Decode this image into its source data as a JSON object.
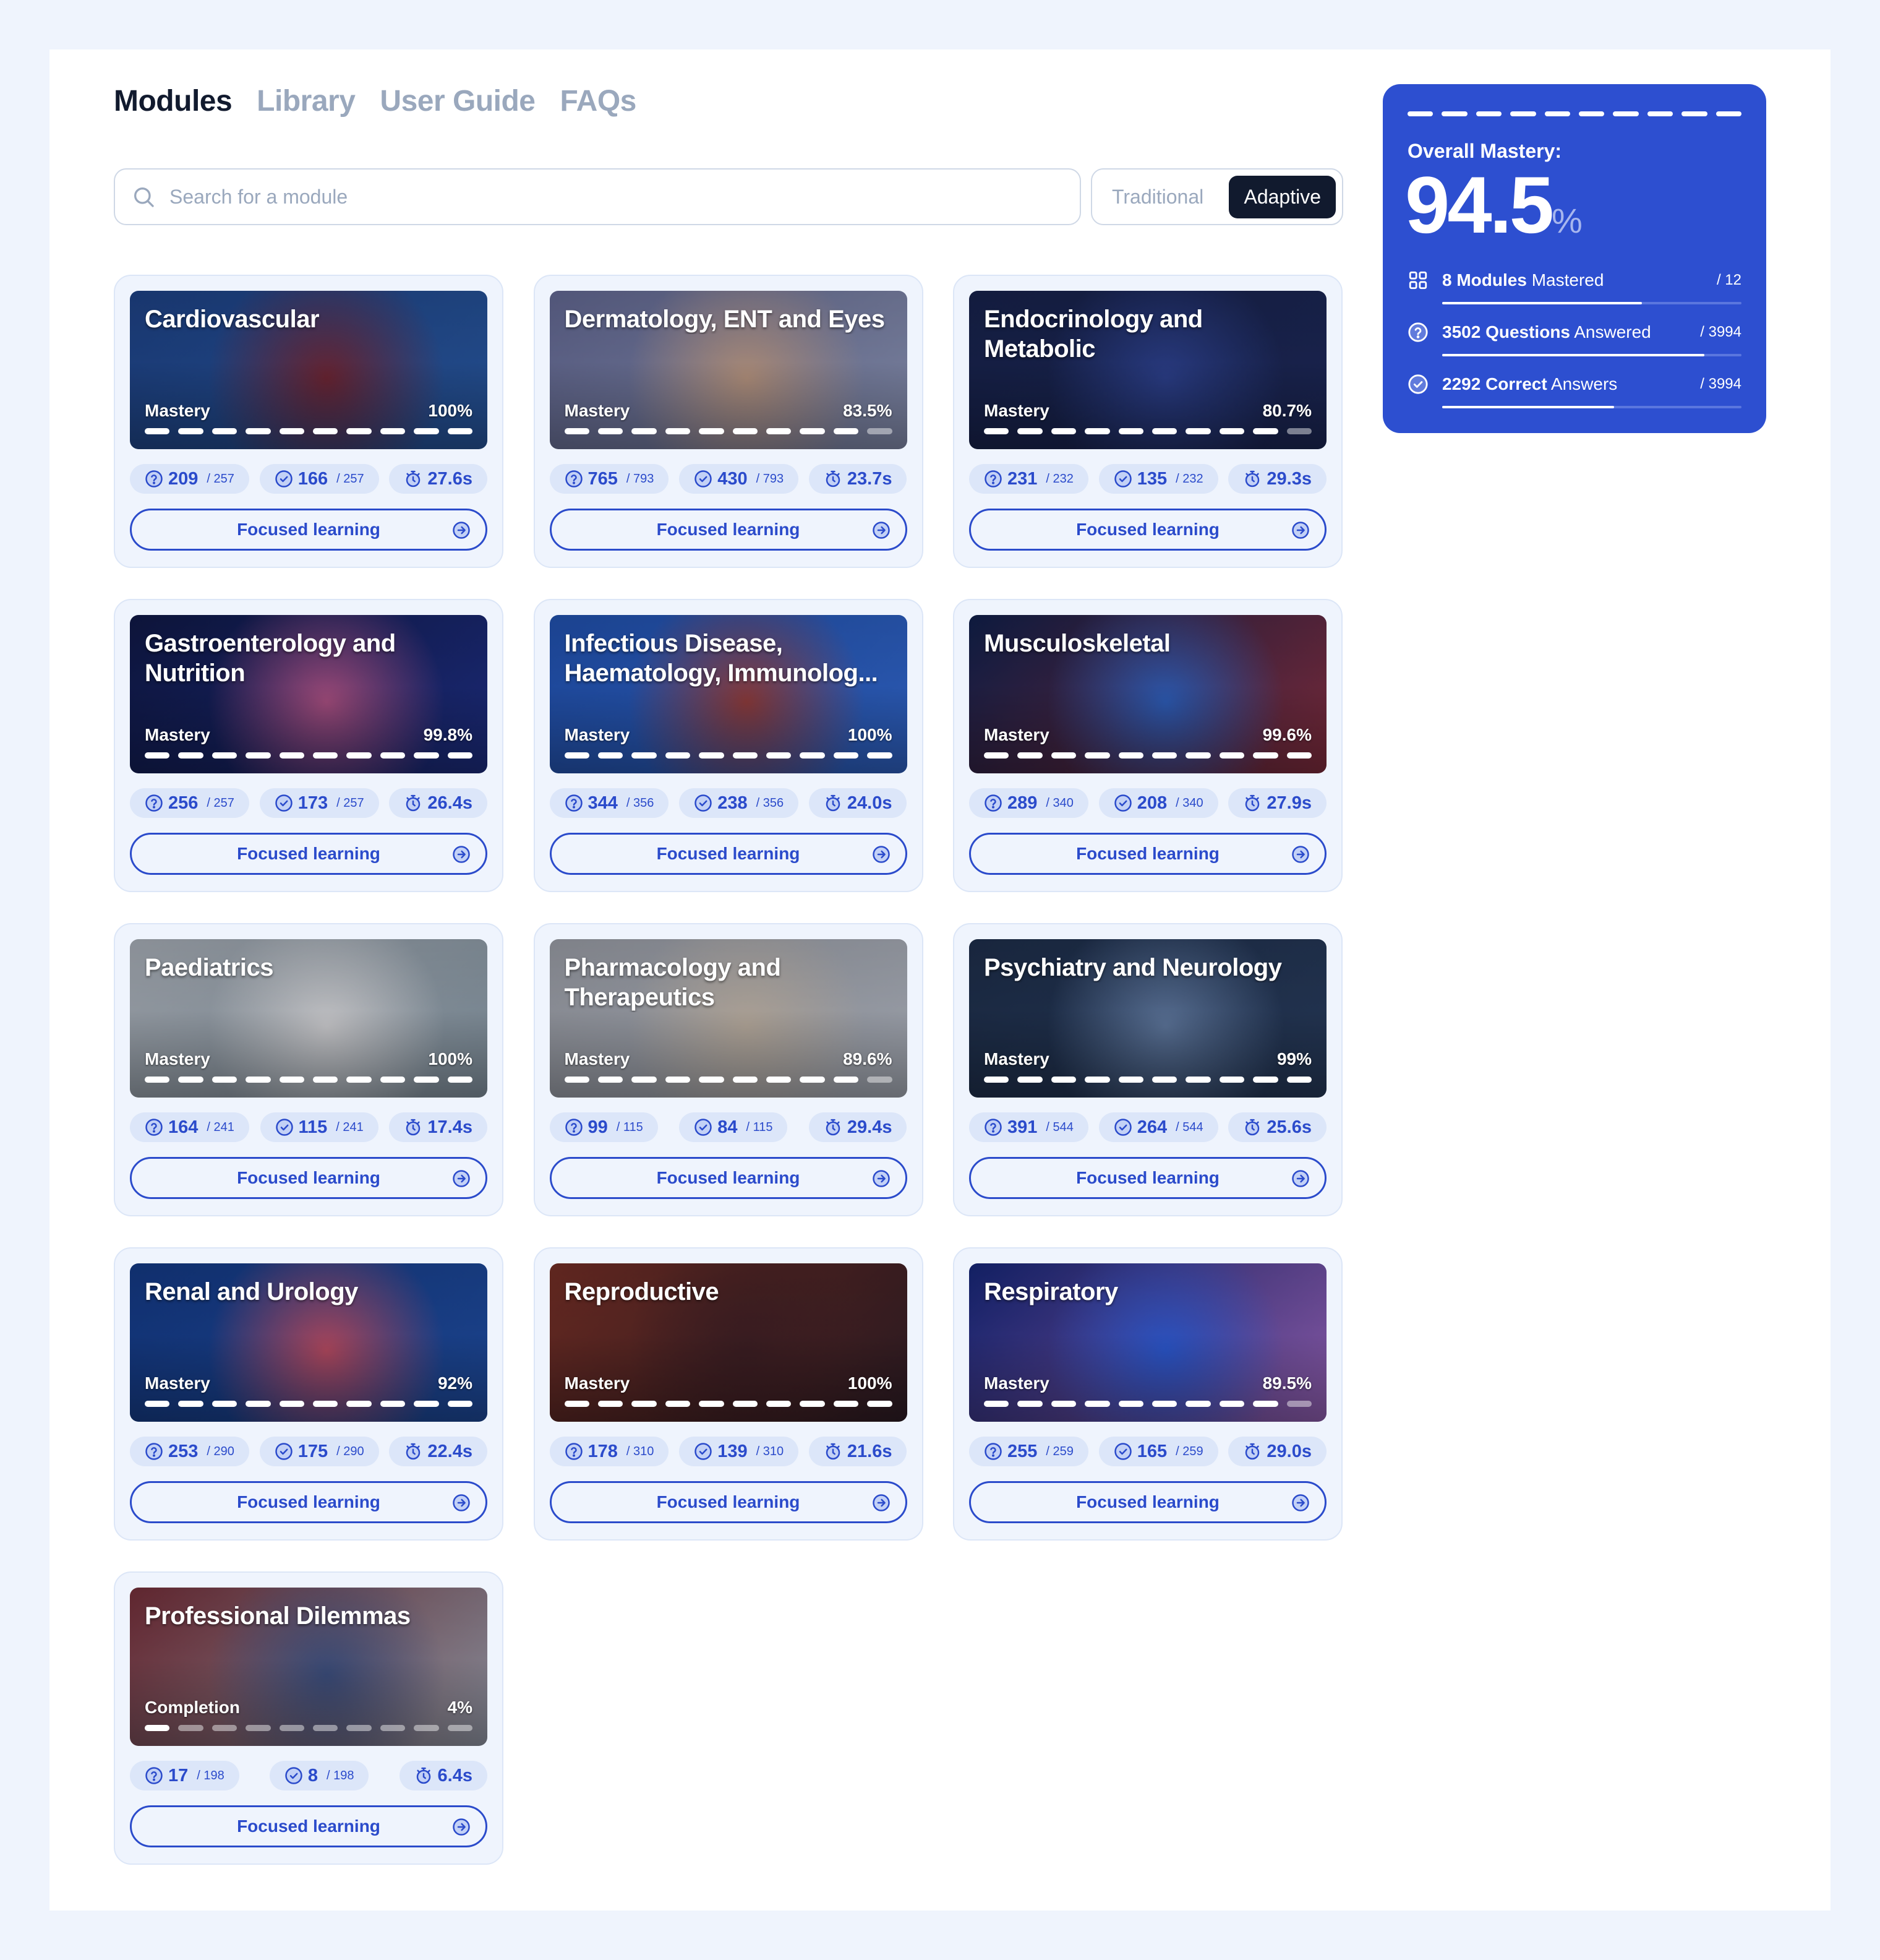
{
  "nav": {
    "tabs": [
      {
        "label": "Modules",
        "active": true
      },
      {
        "label": "Library",
        "active": false
      },
      {
        "label": "User Guide",
        "active": false
      },
      {
        "label": "FAQs",
        "active": false
      }
    ]
  },
  "search": {
    "placeholder": "Search for a module",
    "value": "",
    "icon": "search-icon"
  },
  "mode_toggle": {
    "options": [
      {
        "label": "Traditional",
        "active": false
      },
      {
        "label": "Adaptive",
        "active": true
      }
    ]
  },
  "colors": {
    "accent": "#2D4FD0",
    "accent_text": "#2B4BCB",
    "dark": "#111A2E",
    "muted": "#9AA8BD",
    "page_bg": "#EFF4FD"
  },
  "overall": {
    "label": "Overall Mastery:",
    "value": "94.5",
    "unit": "%",
    "rows": [
      {
        "icon": "grid-icon",
        "count": "8",
        "bold": "Modules",
        "rest": "Mastered",
        "total": "/ 12",
        "fraction": 0.667
      },
      {
        "icon": "question-circle-icon",
        "count": "3502",
        "bold": "Questions",
        "rest": "Answered",
        "total": "/ 3994",
        "fraction": 0.877
      },
      {
        "icon": "check-circle-icon",
        "count": "2292",
        "bold": "Correct",
        "rest": "Answers",
        "total": "/ 3994",
        "fraction": 0.574
      }
    ]
  },
  "focused_label": "Focused learning",
  "modules": [
    {
      "title": "Cardiovascular",
      "metric": "Mastery",
      "value": "100%",
      "segments_filled": 10,
      "answered": "209",
      "answered_total": "/ 257",
      "correct": "166",
      "correct_total": "/ 257",
      "time": "27.6s",
      "theme": [
        "#1b3c7a",
        "#6a2432",
        "#244f91"
      ]
    },
    {
      "title": "Dermatology, ENT and Eyes",
      "metric": "Mastery",
      "value": "83.5%",
      "segments_filled": 9,
      "answered": "765",
      "answered_total": "/ 793",
      "correct": "430",
      "correct_total": "/ 793",
      "time": "23.7s",
      "theme": [
        "#5a5f86",
        "#b08f7b",
        "#7c84a2"
      ]
    },
    {
      "title": "Endocrinology and Metabolic",
      "metric": "Mastery",
      "value": "80.7%",
      "segments_filled": 9,
      "answered": "231",
      "answered_total": "/ 232",
      "correct": "135",
      "correct_total": "/ 232",
      "time": "29.3s",
      "theme": [
        "#151f45",
        "#2a3d86",
        "#1a2450"
      ]
    },
    {
      "title": "Gastroenterology and Nutrition",
      "metric": "Mastery",
      "value": "99.8%",
      "segments_filled": 10,
      "answered": "256",
      "answered_total": "/ 257",
      "correct": "173",
      "correct_total": "/ 257",
      "time": "26.4s",
      "theme": [
        "#0e1640",
        "#a24c7c",
        "#1b2a78"
      ]
    },
    {
      "title": "Infectious Disease, Haematology, Immunolog...",
      "metric": "Mastery",
      "value": "100%",
      "segments_filled": 10,
      "answered": "344",
      "answered_total": "/ 356",
      "correct": "238",
      "correct_total": "/ 356",
      "time": "24.0s",
      "theme": [
        "#1e4aa0",
        "#8a3a3a",
        "#2c5cb8"
      ]
    },
    {
      "title": "Musculoskeletal",
      "metric": "Mastery",
      "value": "99.6%",
      "segments_filled": 10,
      "answered": "289",
      "answered_total": "/ 340",
      "correct": "208",
      "correct_total": "/ 340",
      "time": "27.9s",
      "theme": [
        "#0f1d45",
        "#2c5ab2",
        "#7a2a3a"
      ]
    },
    {
      "title": "Paediatrics",
      "metric": "Mastery",
      "value": "100%",
      "segments_filled": 10,
      "answered": "164",
      "answered_total": "/ 241",
      "correct": "115",
      "correct_total": "/ 241",
      "time": "17.4s",
      "theme": [
        "#9aa0a8",
        "#c9c9cc",
        "#7b8a96"
      ]
    },
    {
      "title": "Pharmacology and Therapeutics",
      "metric": "Mastery",
      "value": "89.6%",
      "segments_filled": 9,
      "answered": "99",
      "answered_total": "/ 115",
      "correct": "84",
      "correct_total": "/ 115",
      "time": "29.4s",
      "theme": [
        "#8d9098",
        "#b3a79a",
        "#9ea3ad"
      ]
    },
    {
      "title": "Psychiatry and Neurology",
      "metric": "Mastery",
      "value": "99%",
      "segments_filled": 10,
      "answered": "391",
      "answered_total": "/ 544",
      "correct": "264",
      "correct_total": "/ 544",
      "time": "25.6s",
      "theme": [
        "#1b2a44",
        "#5b7398",
        "#243654"
      ]
    },
    {
      "title": "Renal and Urology",
      "metric": "Mastery",
      "value": "92%",
      "segments_filled": 10,
      "answered": "253",
      "answered_total": "/ 290",
      "correct": "175",
      "correct_total": "/ 290",
      "time": "22.4s",
      "theme": [
        "#123479",
        "#b0485e",
        "#1c4591"
      ]
    },
    {
      "title": "Reproductive",
      "metric": "Mastery",
      "value": "100%",
      "segments_filled": 10,
      "answered": "178",
      "answered_total": "/ 310",
      "correct": "139",
      "correct_total": "/ 310",
      "time": "21.6s",
      "theme": [
        "#6a2a22",
        "#3a1d22",
        "#2a1a22"
      ]
    },
    {
      "title": "Respiratory",
      "metric": "Mastery",
      "value": "89.5%",
      "segments_filled": 9,
      "answered": "255",
      "answered_total": "/ 259",
      "correct": "165",
      "correct_total": "/ 259",
      "time": "29.0s",
      "theme": [
        "#14236e",
        "#2a55c8",
        "#8a5aa8"
      ]
    },
    {
      "title": "Professional Dilemmas",
      "metric": "Completion",
      "value": "4%",
      "segments_filled": 1,
      "answered": "17",
      "answered_total": "/ 198",
      "correct": "8",
      "correct_total": "/ 198",
      "time": "6.4s",
      "theme": [
        "#6a2a34",
        "#3a4c7a",
        "#8a8f9c"
      ]
    }
  ]
}
